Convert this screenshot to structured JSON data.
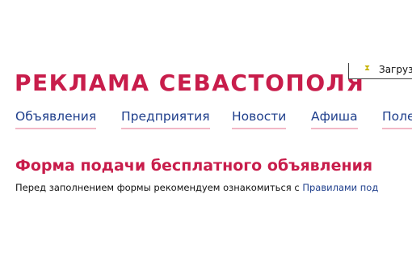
{
  "header": {
    "site_title": "РЕКЛАМА СЕВАСТОПОЛЯ",
    "loading_text": "Загруз",
    "loading_icon": "hourglass-icon"
  },
  "nav": {
    "items": [
      {
        "label": "Объявления"
      },
      {
        "label": "Предприятия"
      },
      {
        "label": "Новости"
      },
      {
        "label": "Афиша"
      },
      {
        "label": "Поле"
      }
    ]
  },
  "main": {
    "title": "Форма подачи бесплатного объявления",
    "intro_text": "Перед заполнением формы рекомендуем ознакомиться с ",
    "rules_link": "Правилами под"
  },
  "colors": {
    "brand": "#c81d4b",
    "link": "#1f3f8c",
    "nav_underline": "#f2b8c6"
  }
}
